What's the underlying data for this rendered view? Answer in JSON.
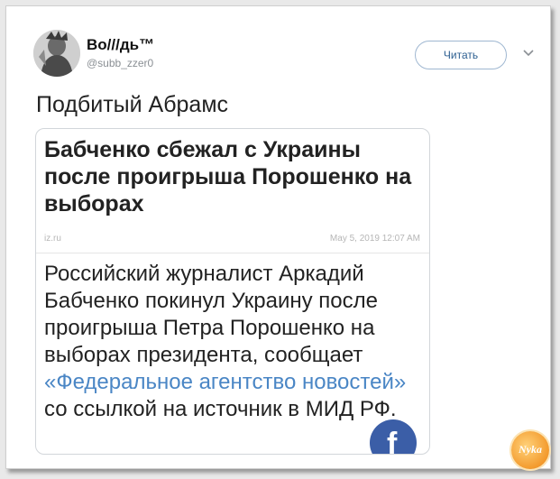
{
  "user": {
    "name": "Bo///дь™",
    "handle": "@subb_zzer0"
  },
  "follow_label": "Читать",
  "tweet_text": "Подбитый Абрамс",
  "card": {
    "headline": "Бабченко сбежал с Украины после проигрыша Порошенко на выборах",
    "source": "iz.ru",
    "date": "May 5, 2019 12:07 AM",
    "body_before": "Российский журналист Аркадий Бабченко покинул Украину после проигрыша Петра Порошенко на выборах президента, сообщает ",
    "body_link": "«Федеральное агентство новостей»",
    "body_after": " со ссылкой на источник в МИД РФ.",
    "share_icon": "facebook-icon",
    "share_glyph": "f"
  },
  "watermark": {
    "text": "Nyka",
    "color": "#f39a2d"
  },
  "colors": {
    "link": "#4a86c5",
    "follow_text": "#2d5f91",
    "facebook": "#3b5ea7"
  }
}
